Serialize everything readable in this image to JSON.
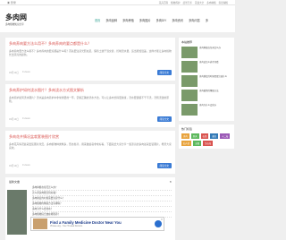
{
  "topbar": {
    "left": "◉ 登录",
    "links": [
      "花卉百科",
      "植物养护",
      "盆景艺术",
      "花语大全",
      "多肉种植",
      "家居绿植"
    ]
  },
  "logo": {
    "title": "多肉网",
    "sub": "多肉植物知识分享"
  },
  "nav": [
    "首页",
    "多肉品种",
    "多肉养殖",
    "多肉图片",
    "多肉DIY",
    "多肉资讯",
    "多肉问答",
    "多"
  ],
  "cards": [
    {
      "title": "多肉养肉要方法么用不？多肉养肉的要点都是什么？",
      "text": "多肉养肉要方法么用不？多肉养肉的要点都是什么呢？首先要注意光照充足，保持土壤干湿交替，控制浇水量，适当增加温差，这样才能让多肉植物长出漂亮的颜色。",
      "date": "03月19日",
      "views": "9 views",
      "btn": "阅读全文"
    },
    {
      "title": "多肉养护如何浇水图片？多肉浇水方式图文解析",
      "text": "多肉养护如何浇水图片？浇水是多肉养护中非常重要的一环，掌握正确的浇水方法，可以让多肉长得更健康，浇水要遵循不干不浇，浇则浇透的原则。",
      "date": "03月19日",
      "views": "9 views",
      "btn": "阅读全文"
    },
    {
      "title": "多肉花卉情况盆栽套装图片欣赏",
      "text": "多肉花卉情况盆栽套装图片欣赏，多肉植物种类繁多，形态各异，用来做盆栽非常好看，下面就给大家分享一些漂亮的多肉盆栽套装图片，希望大家喜欢。",
      "date": "03月19日",
      "views": "9 views",
      "btn": "阅读全文"
    }
  ],
  "recent": {
    "title": "最新文章",
    "items": [
      "多肉种植在冬天怎么办？",
      "怎么养多肉能长得好看？",
      "多肉换盆的时候需要注意什么？",
      "多肉植物的繁殖方法有哪些？",
      "多肉为什么会化水？",
      "多肉植物适合放在哪里养？"
    ]
  },
  "ad": {
    "title": "Find a Family Medicine Doctor Near You",
    "sub": "Vhcare.org - Your Trusted Doctors",
    "close": "✕"
  },
  "sidebar": {
    "hot_title": "本站推荐",
    "hot": [
      "多肉种植在冬天怎么办",
      "多肉该怎么养才好看",
      "多肉换盆的时候需要注意什么",
      "多肉植物的繁殖方法",
      "多肉为什么会化水"
    ],
    "tags_title": "热门标签",
    "tags": [
      {
        "name": "多肉",
        "color": "#e8a33d"
      },
      {
        "name": "景天",
        "color": "#5cb85c"
      },
      {
        "name": "石莲",
        "color": "#d9534f"
      },
      {
        "name": "番杏",
        "color": "#337ab7"
      },
      {
        "name": "十二卷",
        "color": "#9b59b6"
      },
      {
        "name": "仙人掌",
        "color": "#e8a33d"
      },
      {
        "name": "玉露",
        "color": "#5cb85c"
      },
      {
        "name": "生石花",
        "color": "#d9534f"
      }
    ]
  }
}
